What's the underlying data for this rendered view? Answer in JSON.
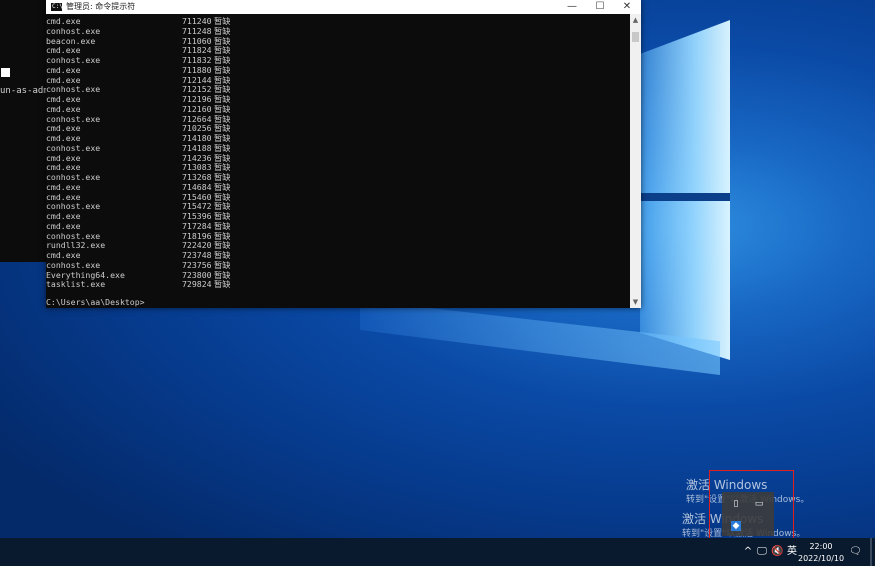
{
  "background_window": {
    "text": "un-as-adm"
  },
  "cmd_window": {
    "title": "管理员: 命令提示符",
    "controls": {
      "minimize": "—",
      "maximize": "☐",
      "close": "✕"
    },
    "rows": [
      {
        "name": "cmd.exe",
        "mem": "711240",
        "unit": "暂缺"
      },
      {
        "name": "conhost.exe",
        "mem": "711248",
        "unit": "暂缺"
      },
      {
        "name": "beacon.exe",
        "mem": "711060",
        "unit": "暂缺"
      },
      {
        "name": "cmd.exe",
        "mem": "711824",
        "unit": "暂缺"
      },
      {
        "name": "conhost.exe",
        "mem": "711832",
        "unit": "暂缺"
      },
      {
        "name": "cmd.exe",
        "mem": "711880",
        "unit": "暂缺"
      },
      {
        "name": "cmd.exe",
        "mem": "712144",
        "unit": "暂缺"
      },
      {
        "name": "conhost.exe",
        "mem": "712152",
        "unit": "暂缺"
      },
      {
        "name": "cmd.exe",
        "mem": "712196",
        "unit": "暂缺"
      },
      {
        "name": "cmd.exe",
        "mem": "712160",
        "unit": "暂缺"
      },
      {
        "name": "conhost.exe",
        "mem": "712664",
        "unit": "暂缺"
      },
      {
        "name": "cmd.exe",
        "mem": "710256",
        "unit": "暂缺"
      },
      {
        "name": "cmd.exe",
        "mem": "714180",
        "unit": "暂缺"
      },
      {
        "name": "conhost.exe",
        "mem": "714188",
        "unit": "暂缺"
      },
      {
        "name": "cmd.exe",
        "mem": "714236",
        "unit": "暂缺"
      },
      {
        "name": "cmd.exe",
        "mem": "713083",
        "unit": "暂缺"
      },
      {
        "name": "conhost.exe",
        "mem": "713268",
        "unit": "暂缺"
      },
      {
        "name": "cmd.exe",
        "mem": "714684",
        "unit": "暂缺"
      },
      {
        "name": "cmd.exe",
        "mem": "715460",
        "unit": "暂缺"
      },
      {
        "name": "conhost.exe",
        "mem": "715472",
        "unit": "暂缺"
      },
      {
        "name": "cmd.exe",
        "mem": "715396",
        "unit": "暂缺"
      },
      {
        "name": "cmd.exe",
        "mem": "717284",
        "unit": "暂缺"
      },
      {
        "name": "conhost.exe",
        "mem": "718196",
        "unit": "暂缺"
      },
      {
        "name": "rundll32.exe",
        "mem": "722420",
        "unit": "暂缺"
      },
      {
        "name": "cmd.exe",
        "mem": "723748",
        "unit": "暂缺"
      },
      {
        "name": "conhost.exe",
        "mem": "723756",
        "unit": "暂缺"
      },
      {
        "name": "Everything64.exe",
        "mem": "723800",
        "unit": "暂缺"
      },
      {
        "name": "tasklist.exe",
        "mem": "729824",
        "unit": "暂缺"
      }
    ],
    "prompt": "C:\\Users\\aa\\Desktop>"
  },
  "watermark": {
    "title": "激活 Windows",
    "subtitle": "转到\"设置\"以激活 Windows。"
  },
  "taskbar": {
    "tray_chevron": "^",
    "ime": "英",
    "time": "22:00",
    "date": "2022/10/10"
  },
  "colors": {
    "highlight": "#e02020",
    "console_bg": "#0c0c0c",
    "console_text": "#cccccc"
  }
}
